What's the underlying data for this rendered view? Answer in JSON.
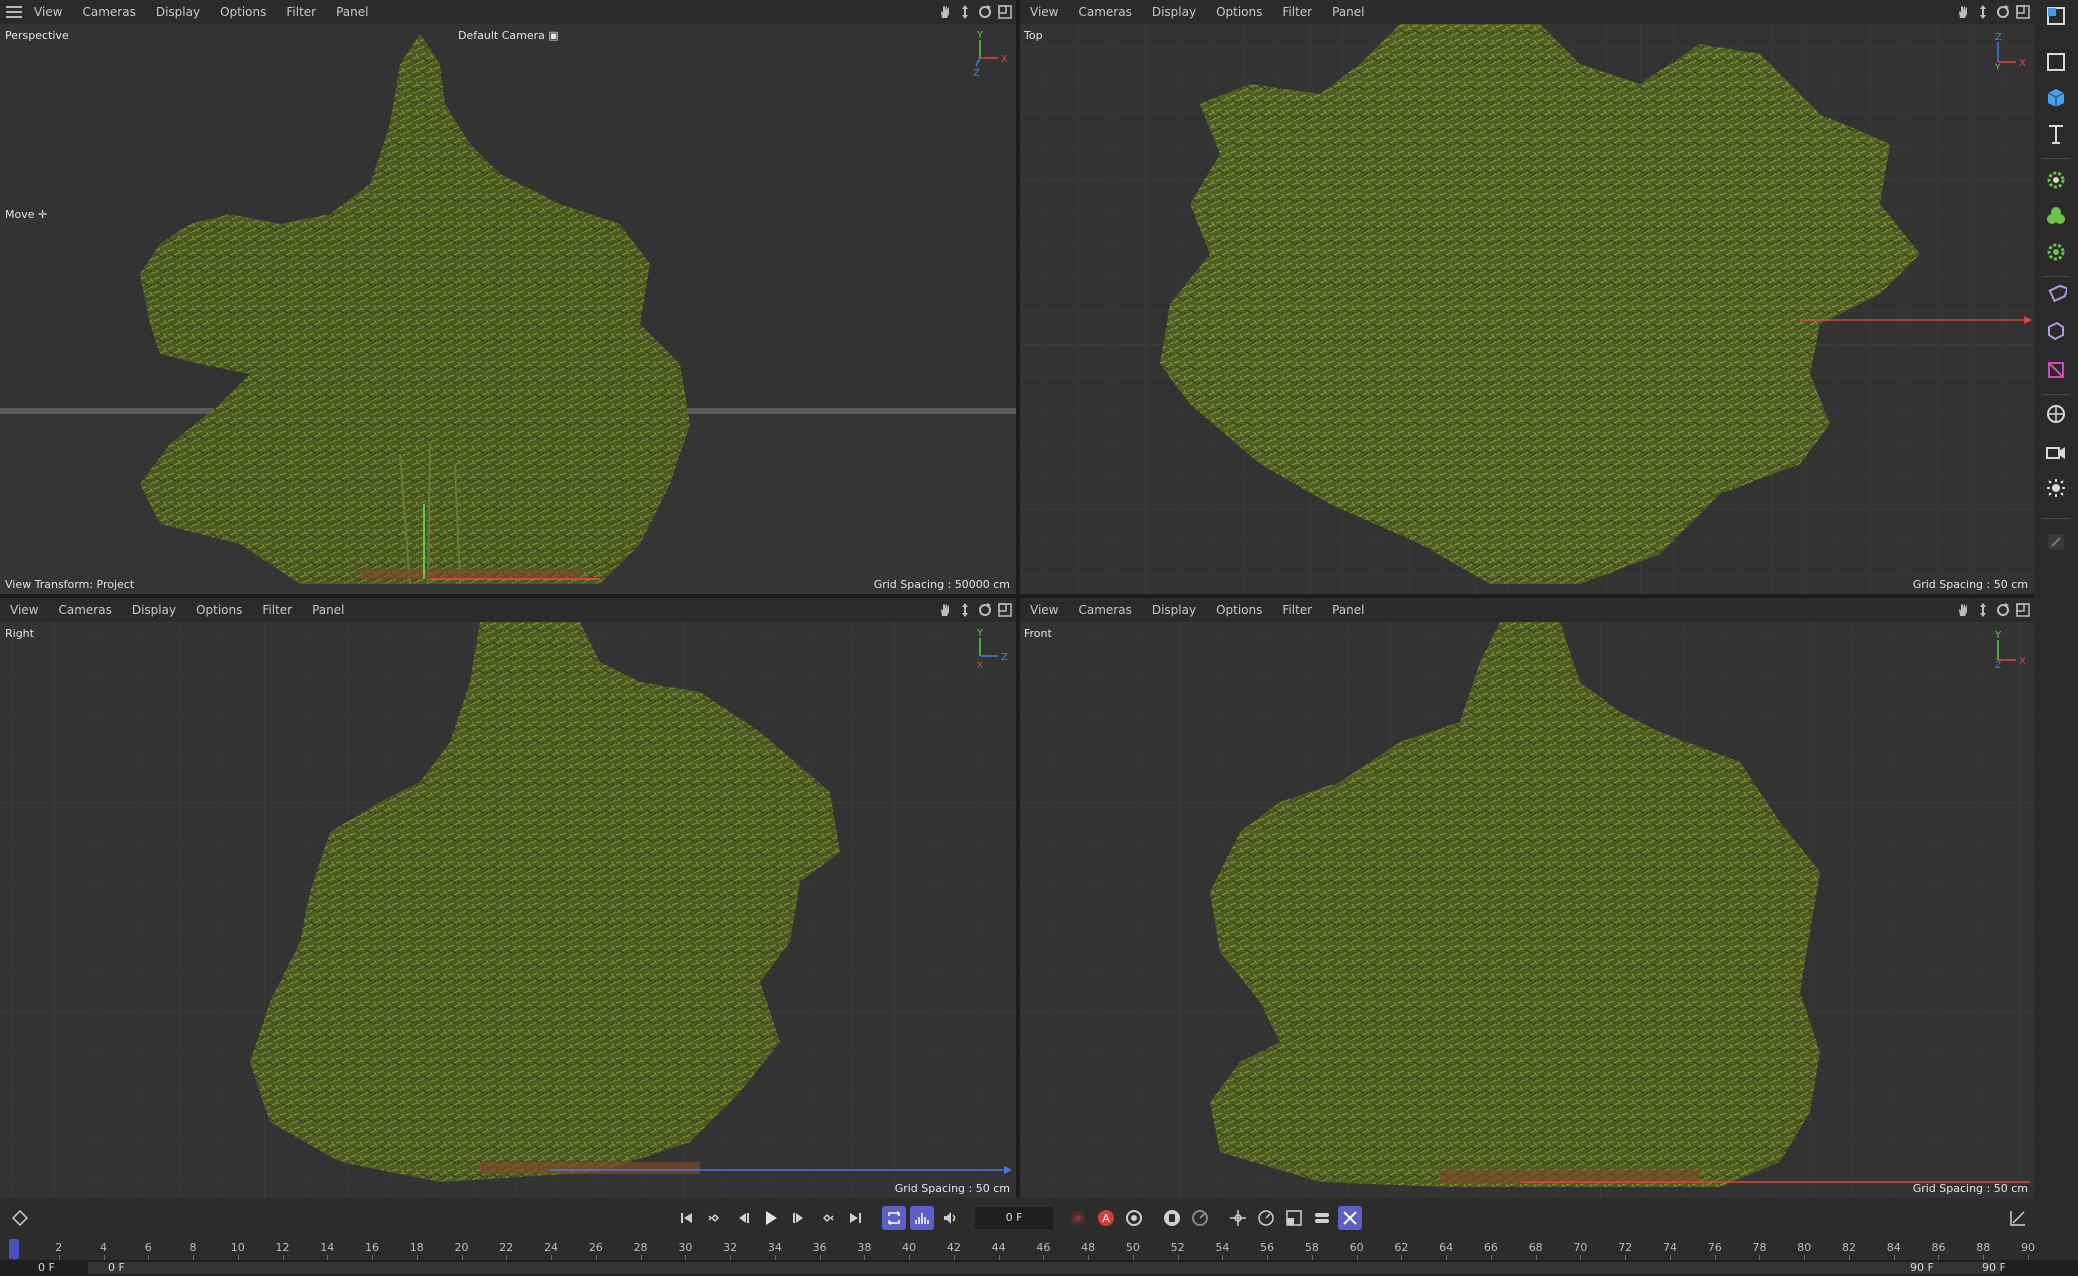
{
  "menus": [
    "View",
    "Cameras",
    "Display",
    "Options",
    "Filter",
    "Panel"
  ],
  "viewports": {
    "perspective": {
      "label": "Perspective",
      "camera": "Default Camera",
      "tool": "Move",
      "view_transform": "View Transform: Project",
      "grid_spacing": "Grid Spacing : 50000 cm"
    },
    "top": {
      "label": "Top",
      "grid_spacing": "Grid Spacing : 50 cm"
    },
    "right": {
      "label": "Right",
      "grid_spacing": "Grid Spacing : 50 cm"
    },
    "front": {
      "label": "Front",
      "grid_spacing": "Grid Spacing : 50 cm"
    }
  },
  "axes": {
    "x": "X",
    "y": "Y",
    "z": "Z"
  },
  "colors": {
    "axis_x": "#d94444",
    "axis_y": "#5fcc4a",
    "axis_z": "#4a78e0",
    "foliage_dark": "#3d4a1e",
    "foliage_mid": "#5a6a2a",
    "foliage_light": "#7d8c3c",
    "active_button": "#5b5fc7"
  },
  "right_toolbar": {
    "icons": [
      "view-layout-icon",
      "cube-outline-icon",
      "cube-solid-icon",
      "text-tool-icon",
      "spline-gear-icon",
      "generator-icon",
      "deformer-gear-icon",
      "tag-icon",
      "field-icon",
      "material-icon",
      "environment-icon",
      "camera-icon",
      "light-icon",
      "extra-tool-icon"
    ]
  },
  "timeline": {
    "current_frame": "0 F",
    "start_frame": "0 F",
    "preview_start": "0 F",
    "preview_end": "90 F",
    "end_frame": "90 F",
    "ticks": [
      0,
      2,
      4,
      6,
      8,
      10,
      12,
      14,
      16,
      18,
      20,
      22,
      24,
      26,
      28,
      30,
      32,
      34,
      36,
      38,
      40,
      42,
      44,
      46,
      48,
      50,
      52,
      54,
      56,
      58,
      60,
      62,
      64,
      66,
      68,
      70,
      72,
      74,
      76,
      78,
      80,
      82,
      84,
      86,
      88,
      90
    ],
    "playhead_frame": 0,
    "transport_icons": [
      "goto-start-icon",
      "prev-key-icon",
      "prev-frame-icon",
      "play-icon",
      "next-frame-icon",
      "next-key-icon",
      "goto-end-icon",
      "loop-icon",
      "bounce-icon",
      "sound-icon"
    ],
    "record_icons": [
      "record-disabled-icon",
      "autokey-icon",
      "keyframe-settings-icon",
      "motion-icon",
      "onion-icon",
      "position-key-icon",
      "rotation-key-icon",
      "scale-key-icon",
      "param-key-icon",
      "pla-key-icon"
    ]
  }
}
